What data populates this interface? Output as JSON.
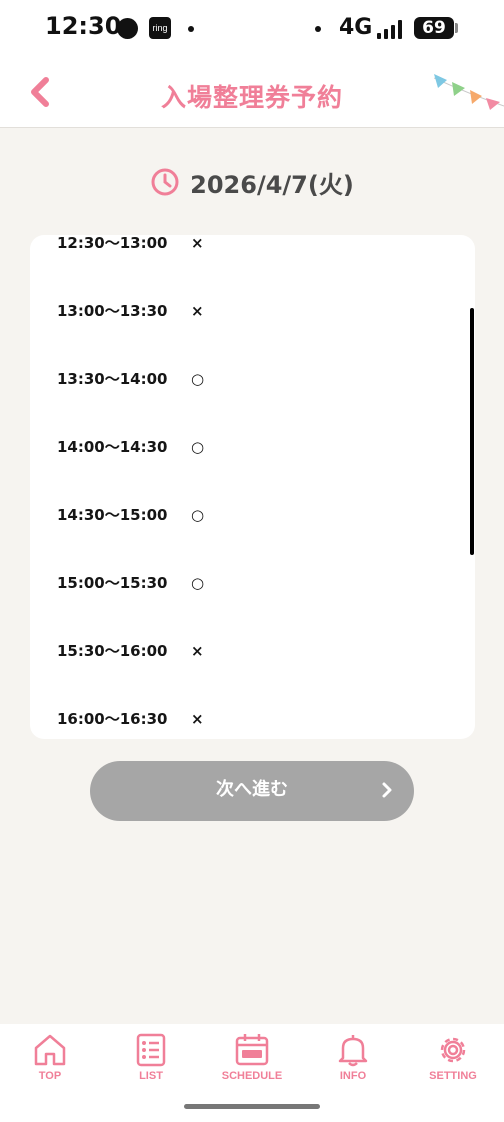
{
  "status_bar": {
    "time": "12:30",
    "ring_label": "ring",
    "network": "4G",
    "battery": "69"
  },
  "header": {
    "title": "入場整理券予約"
  },
  "date": {
    "label": "2026/4/7(火)"
  },
  "slots": [
    {
      "time": "12:30〜13:00",
      "mark": "×"
    },
    {
      "time": "13:00〜13:30",
      "mark": "×"
    },
    {
      "time": "13:30〜14:00",
      "mark": "○"
    },
    {
      "time": "14:00〜14:30",
      "mark": "○"
    },
    {
      "time": "14:30〜15:00",
      "mark": "○"
    },
    {
      "time": "15:00〜15:30",
      "mark": "○"
    },
    {
      "time": "15:30〜16:00",
      "mark": "×"
    },
    {
      "time": "16:00〜16:30",
      "mark": "×"
    }
  ],
  "next_button": {
    "label": "次へ進む"
  },
  "bottom_nav": {
    "items": [
      {
        "label": "TOP",
        "icon": "home-icon"
      },
      {
        "label": "LIST",
        "icon": "list-icon"
      },
      {
        "label": "SCHEDULE",
        "icon": "calendar-ticket-icon"
      },
      {
        "label": "INFO",
        "icon": "bell-icon"
      },
      {
        "label": "SETTING",
        "icon": "gear-icon"
      }
    ]
  },
  "colors": {
    "accent": "#f07f98",
    "background": "#f6f4f0",
    "button_disabled": "#a6a6a6"
  }
}
